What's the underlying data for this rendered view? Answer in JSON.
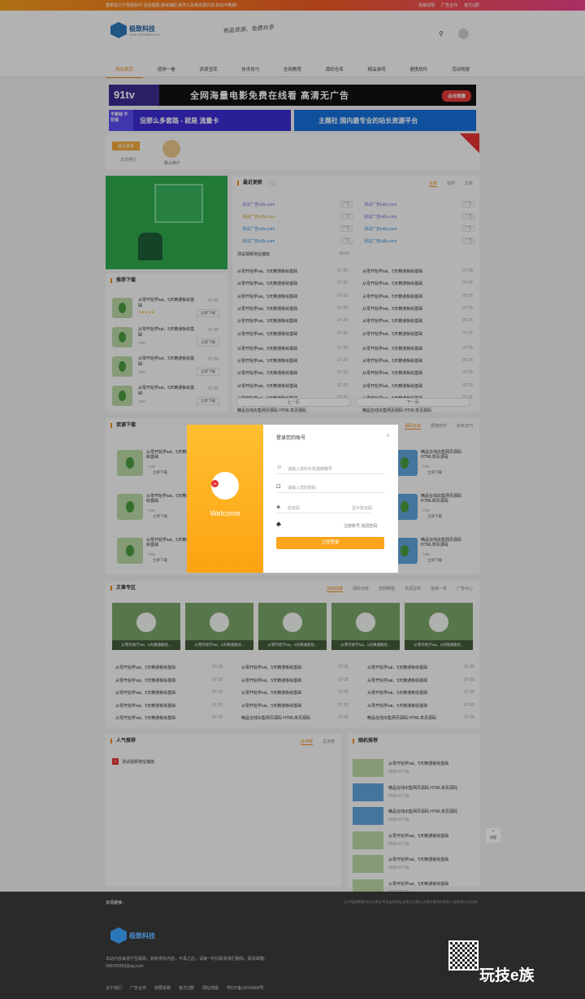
{
  "topbar": {
    "notice": "香蕉能力于视频软件,活动插图,游戏辅助,操作工具等资源共享,好玩不断篇！",
    "links": [
      "投稿说明",
      "广告合作",
      "官方Q群"
    ]
  },
  "header": {
    "logo_title": "极致科技",
    "logo_sub": "JIZHI TECHNOLOGY",
    "slogan": "有品资源，免费共享"
  },
  "nav": [
    "网站首页",
    "值得一看",
    "资源宝库",
    "技术技巧",
    "全网教程",
    "源码仓库",
    "精品游戏",
    "便携软件",
    "活动线报"
  ],
  "banners": {
    "b1_logo": "91tv",
    "b1_text": "全网海量电影免费在线看  高清无广告",
    "b1_btn": "点击观看",
    "b2_left": "不要钱 不花钱",
    "b2_text": "没那么多套路 - 就是 流量卡",
    "b3_text": "主题社  国内最专业的站长资源平台"
  },
  "user": {
    "tag": "最近登录",
    "tag2": "本周排行",
    "name": "默认用户"
  },
  "recommend": {
    "title": "推荐下载",
    "items": [
      {
        "title": "从零开始学sai，5天精通板绘基础",
        "date": "07-25",
        "size": "73M",
        "btn": "立即下载",
        "stars": "★★★★★"
      },
      {
        "title": "从零开始学sai，5天精通板绘基础",
        "date": "07-25",
        "size": "73M",
        "btn": "立即下载"
      },
      {
        "title": "从零开始学sai，5天精通板绘基础",
        "date": "07-25",
        "size": "73M",
        "btn": "立即下载"
      },
      {
        "title": "从零开始学sai，5天精通板绘基础",
        "date": "07-25",
        "size": "73M",
        "btn": "立即下载"
      }
    ]
  },
  "latest": {
    "title": "最近更新",
    "count": "+1",
    "tabs": [
      "全部",
      "软件",
      "文章"
    ],
    "ads": [
      "测试广告lu8u.com",
      "测试广告lu8u.com",
      "测试广告lu8u.com",
      "测试广告lu8u.com",
      "测试广告lu8u.com",
      "测试广告lu8u.com",
      "测试广告lu8u.com",
      "测试广告lu8u.com"
    ],
    "ad_badge": "广告",
    "first": {
      "title": "测试视频地址播放",
      "date": "08-01"
    },
    "rows_l": [
      "从零开始学sai，5天精通板绘基础",
      "从零开始学sai，5天精通板绘基础",
      "从零开始学sai，5天精通板绘基础",
      "从零开始学sai，5天精通板绘基础",
      "从零开始学sai，5天精通板绘基础",
      "从零开始学sai，5天精通板绘基础",
      "从零开始学sai，5天精通板绘基础",
      "从零开始学sai，5天精通板绘基础",
      "从零开始学sai，5天精通板绘基础",
      "从零开始学sai，5天精通板绘基础",
      "从零开始学sai，5天精通板绘基础",
      "精品在线出售网页源码 HTML单页源码"
    ],
    "rows_r": [
      "从零开始学sai，5天精通板绘基础",
      "从零开始学sai，5天精通板绘基础",
      "从零开始学sai，5天精通板绘基础",
      "从零开始学sai，5天精通板绘基础",
      "从零开始学sai，5天精通板绘基础",
      "从零开始学sai，5天精通板绘基础",
      "从零开始学sai，5天精通板绘基础",
      "从零开始学sai，5天精通板绘基础",
      "从零开始学sai，5天精通板绘基础",
      "从零开始学sai，5天精通板绘基础",
      "从零开始学sai，5天精通板绘基础",
      "精品在线出售网页源码 HTML单页源码"
    ],
    "date": "07-25",
    "prev": "上一页",
    "next": "下一页"
  },
  "resources": {
    "title": "资源下载",
    "tabs": [
      "源码仓库",
      "便携软件",
      "技术技巧"
    ],
    "item_title": "从零开始学sai，5天精通板绘基础",
    "item_title_r": "精品在线出售网页源码 HTML单页源码",
    "size": "73M",
    "btn": "立即下载"
  },
  "articles": {
    "title": "文章专区",
    "tabs": [
      "活动线报",
      "源码仓库",
      "全网教程",
      "资源宝库",
      "值得一看",
      "广告中心"
    ],
    "card": "从零开始学sai，5天精通板绘...",
    "row": "从零开始学sai，5天精通板绘基础",
    "row_alt": "精品在线出售网页源码 HTML单页源码",
    "date": "07-25"
  },
  "popular": {
    "title": "人气推荐",
    "tabs": [
      "总评榜",
      "总浏榜"
    ],
    "rank": "1",
    "item": "测试视频地址播放"
  },
  "random": {
    "title": "随机推荐",
    "items": [
      {
        "title": "从零开始学sai，5天精通板绘基础",
        "date": "2020-07-25",
        "icon": "green"
      },
      {
        "title": "精品在线出售网页源码 HTML单页源码",
        "date": "2020-07-25",
        "icon": "blue"
      },
      {
        "title": "精品在线出售网页源码 HTML单页源码",
        "date": "2020-07-25",
        "icon": "blue"
      },
      {
        "title": "从零开始学sai，5天精通板绘基础",
        "date": "2020-07-25",
        "icon": "green"
      },
      {
        "title": "从零开始学sai，5天精通板绘基础",
        "date": "2020-07-25",
        "icon": "green"
      },
      {
        "title": "从零开始学sai，5天精通板绘基础",
        "date": "2020-07-25",
        "icon": "green"
      }
    ]
  },
  "footer": {
    "friend_label": "友情链接：",
    "friend_right": "(文字链接需要时)站点建设/专用自助网站/自建正在建立/交换任意网站资源(一起联络CNN互联)",
    "logo_title": "极致科技",
    "desc": "本站内容来源于互联网，如有侵权内容，不承之后，请第一时间联系我们删除。联系邮箱：",
    "email": "995005893@qq.com",
    "links": [
      "关于我们",
      "广告合作",
      "我要投稿",
      "官方Q群",
      "网站地图"
    ],
    "icp": "粤ICP备18016668号",
    "brand": "玩技e族"
  },
  "backtop": "顶部",
  "modal": {
    "welcome": "Welcome",
    "title": "登录您的账号",
    "phone_ph": "请输入您的手机或邮箱号",
    "pwd_ph": "请输入您的密码",
    "code_ph": "验证码",
    "code_btn": "显示验证码",
    "register": "注册账号",
    "forgot": "找回密码",
    "submit": "立即登录"
  }
}
